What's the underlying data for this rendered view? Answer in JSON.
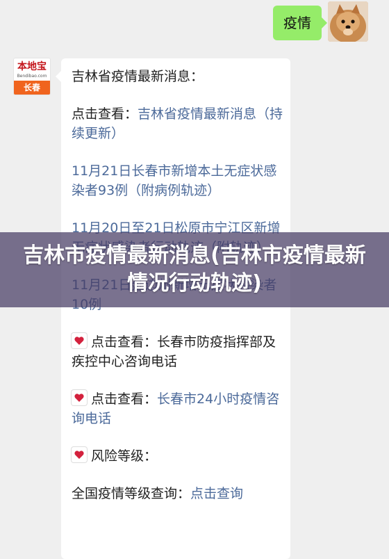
{
  "chat": {
    "user_message": "疫情",
    "sender_logo": {
      "top": "本地宝",
      "url": "Bendibao.com",
      "city": "长春"
    },
    "article": {
      "title_line": "吉林省疫情最新消息：",
      "check_prefix": "点击查看：",
      "check_link": "吉林省疫情最新消息（持续更新）",
      "link_1": "11月21日长春市新增本土无症状感染者93例（附病例轨迹）",
      "link_2": "11月20日至21日松原市宁江区新增无症状感染者行动轨迹（附轨迹）",
      "link_3": "11月21日延边州新增无症状感染者10例",
      "item_1_prefix": "点击查看：",
      "item_1_text": "长春市防疫指挥部及疾控中心咨询电话",
      "item_2_prefix": "点击查看：",
      "item_2_link": "长春市24小时疫情咨询电话",
      "risk_label": "风险等级：",
      "national_prefix": "全国疫情等级查询：",
      "national_link": "点击查询"
    }
  },
  "overlay": {
    "title": "吉林市疫情最新消息(吉林市疫情最新情况行动轨迹)"
  },
  "colors": {
    "user_bubble": "#95ec69",
    "link": "#4c6a9a",
    "logo_red": "#c4161c",
    "logo_orange": "#f0641e"
  },
  "icons": [
    "heart-letter-icon"
  ]
}
